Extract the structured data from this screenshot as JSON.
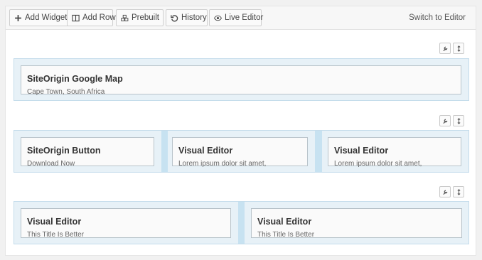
{
  "toolbar": {
    "add_widget": "Add Widget",
    "add_row": "Add Row",
    "prebuilt": "Prebuilt",
    "history": "History",
    "live_editor": "Live Editor",
    "switch": "Switch to Editor"
  },
  "rows": [
    {
      "widgets": [
        {
          "title": "SiteOrigin Google Map",
          "desc": "Cape Town, South Africa"
        }
      ]
    },
    {
      "widgets": [
        {
          "title": "SiteOrigin Button",
          "desc": "Download Now"
        },
        {
          "title": "Visual Editor",
          "desc": "Lorem ipsum dolor sit amet,"
        },
        {
          "title": "Visual Editor",
          "desc": "Lorem ipsum dolor sit amet,"
        }
      ]
    },
    {
      "widgets": [
        {
          "title": "Visual Editor",
          "desc": "This Title Is Better"
        },
        {
          "title": "Visual Editor",
          "desc": "This Title Is Better"
        }
      ]
    }
  ],
  "icons": {
    "add_widget": "plus-icon",
    "add_row": "columns-icon",
    "prebuilt": "cubes-icon",
    "history": "undo-icon",
    "live_editor": "eye-icon",
    "row_edit": "wrench-icon",
    "row_move": "move-icon"
  },
  "colors": {
    "row_background": "#dcebf3",
    "cell_sizer": "#c7e2f1",
    "widget_border": "#b8c3ca"
  }
}
